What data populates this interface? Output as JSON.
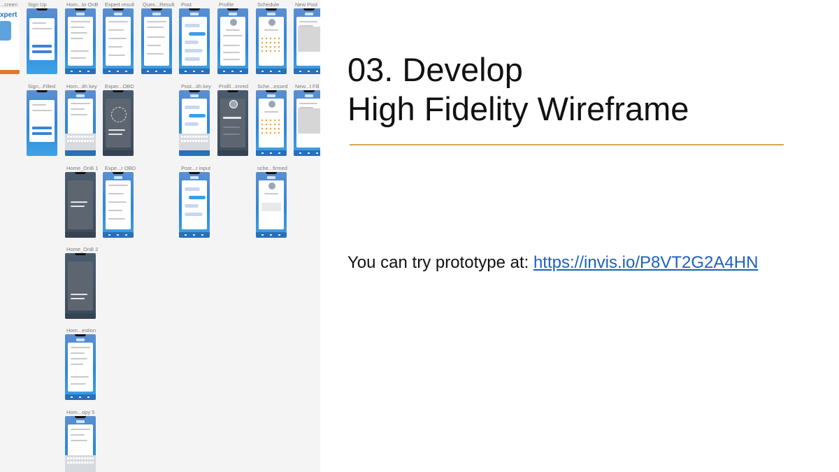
{
  "artboard_labels": [
    "...creen",
    "Sign Up",
    "Hom...to OnB",
    "Expert result",
    "Ques...Result",
    "Post",
    "Profile",
    "Schedule",
    "New Post",
    "Sign...Filled",
    "Hom...ith key",
    "Exper...OBD",
    "Post...ith key",
    "Profil...imred",
    "Sche...essed",
    "New...t Fill",
    "Home_OnB 1",
    "Expe...r OBD",
    "Post...r input",
    "sche...firmed",
    "Home_OnB 2",
    "Hom...estion",
    "Hom...opy 5"
  ],
  "slide": {
    "title_line1": "03. Develop",
    "title_line2": "High Fidelity Wireframe",
    "prototype_prefix": "You can try prototype at: ",
    "prototype_link": " https://invis.io/P8VT2G2A4HN"
  },
  "colors": {
    "divider": "#d9a55a",
    "link": "#1f5fbf",
    "screen_blue": "#2f86d8"
  }
}
